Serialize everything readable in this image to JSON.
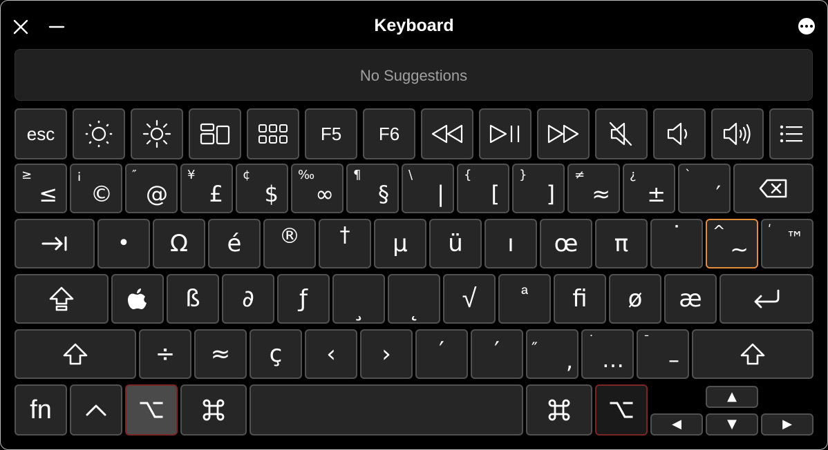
{
  "window": {
    "title": "Keyboard"
  },
  "suggestions": {
    "text": "No Suggestions"
  },
  "row1": {
    "esc": "esc",
    "f5": "F5",
    "f6": "F6"
  },
  "row2": [
    {
      "hi": "≥",
      "lo": "≤"
    },
    {
      "hi": "¡",
      "lo": "©"
    },
    {
      "hi": "″",
      "lo": "@"
    },
    {
      "hi": "¥",
      "lo": "£"
    },
    {
      "hi": "¢",
      "lo": "$"
    },
    {
      "hi": "‰",
      "lo": "∞"
    },
    {
      "hi": "¶",
      "lo": "§"
    },
    {
      "hi": "\\",
      "lo": "|"
    },
    {
      "hi": "{",
      "lo": "["
    },
    {
      "hi": "}",
      "lo": "]"
    },
    {
      "hi": "≠",
      "lo": "≈"
    },
    {
      "hi": "¿",
      "lo": "±"
    },
    {
      "hi": "`",
      "lo": "′"
    }
  ],
  "row3": [
    "•",
    "Ω",
    "é",
    "®",
    "†",
    "µ",
    "ü",
    "ı",
    "œ",
    "π",
    "˙",
    "~",
    "™"
  ],
  "row3_dead": {
    "hi": "^",
    "hi2": "ʹ"
  },
  "row4": [
    "ß",
    "∂",
    "ƒ",
    "¸",
    "˛",
    "√",
    "ª",
    "ﬁ",
    "ø",
    "æ"
  ],
  "row5": [
    "÷",
    "≈",
    "ç",
    "‹",
    "›",
    "′",
    "′",
    "″",
    ",",
    "…",
    "–"
  ],
  "row5_extra": {
    "hi1": "˙",
    "hi2": "¯"
  },
  "row6": {
    "fn": "fn",
    "ctrl": "^"
  },
  "arrows": {
    "up": "▲",
    "left": "◀",
    "down": "▼",
    "right": "▶"
  },
  "colors": {
    "key_bg": "#262626",
    "key_border": "#515151",
    "active_border": "#e48b3c",
    "modifier_border": "#7a2626"
  }
}
